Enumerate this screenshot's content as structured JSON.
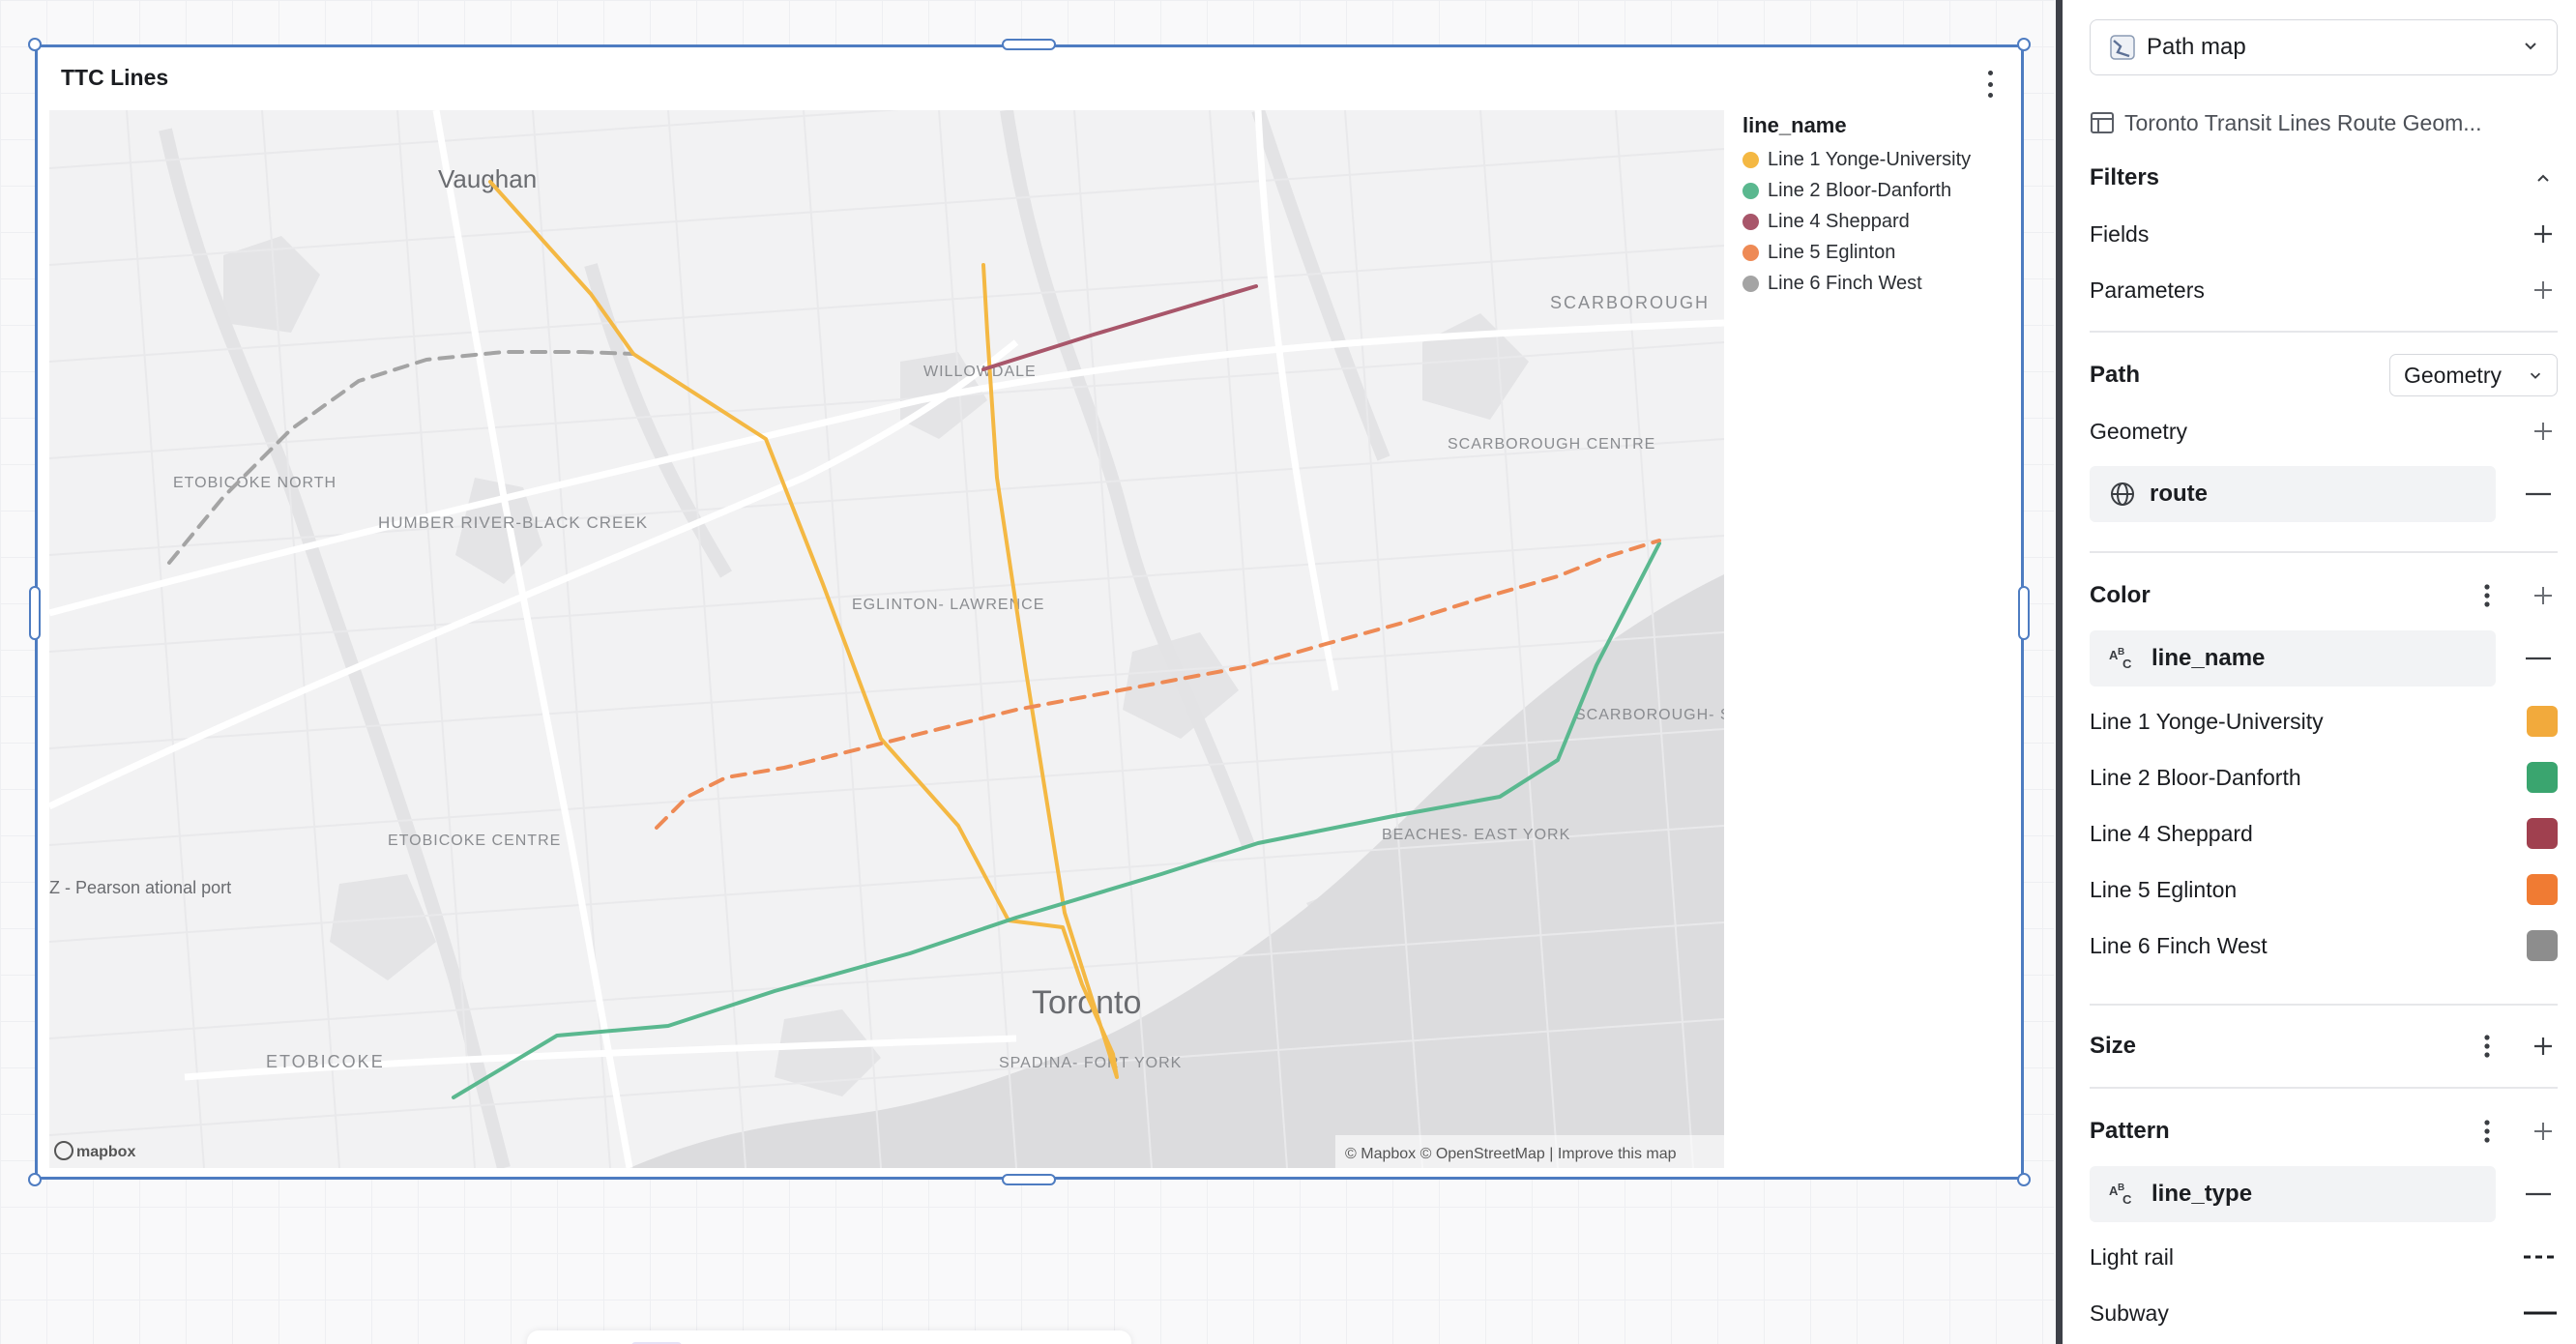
{
  "card": {
    "title": "TTC Lines"
  },
  "map": {
    "place_labels": {
      "vaughan": "Vaughan",
      "scarborough": "SCARBOROUGH",
      "willowdale": "WILLOWDALE",
      "etobicoke_north": "ETOBICOKE NORTH",
      "humber_river_black_creek": "HUMBER RIVER-BLACK CREEK",
      "scarborough_centre": "SCARBOROUGH CENTRE",
      "eglinton_lawrence": "EGLINTON- LAWRENCE",
      "scarborough_southwest": "SCARBOROUGH- SOUTHWEST",
      "beaches_east_york": "BEACHES- EAST YORK",
      "etobicoke_centre": "ETOBICOKE CENTRE",
      "pearson": "Z - Pearson ational port",
      "toronto": "Toronto",
      "spadina_fort_york": "SPADINA- FORT YORK",
      "etobicoke": "ETOBICOKE"
    },
    "logo": "mapbox",
    "attribution": "© Mapbox © OpenStreetMap | Improve this map"
  },
  "legend": {
    "title": "line_name",
    "items": [
      {
        "label": "Line 1 Yonge-University",
        "color": "#f4b843"
      },
      {
        "label": "Line 2 Bloor-Danforth",
        "color": "#5ab88f"
      },
      {
        "label": "Line 4 Sheppard",
        "color": "#a8566a"
      },
      {
        "label": "Line 5 Eglinton",
        "color": "#ee8a55"
      },
      {
        "label": "Line 6 Finch West",
        "color": "#a4a4a4"
      }
    ]
  },
  "panel": {
    "viz_type": "Path map",
    "viz_icon": "path-map-icon",
    "dataset": "Toronto Transit Lines Route Geom...",
    "filters": {
      "title": "Filters",
      "fields": "Fields",
      "parameters": "Parameters"
    },
    "path": {
      "title": "Path",
      "mode": "Geometry",
      "geometry_label": "Geometry",
      "field": "route"
    },
    "color": {
      "title": "Color",
      "field": "line_name",
      "values": [
        {
          "label": "Line 1 Yonge-University",
          "color": "#f2aa3c"
        },
        {
          "label": "Line 2 Bloor-Danforth",
          "color": "#3aa56f"
        },
        {
          "label": "Line 4 Sheppard",
          "color": "#a0404f"
        },
        {
          "label": "Line 5 Eglinton",
          "color": "#f07b33"
        },
        {
          "label": "Line 6 Finch West",
          "color": "#8d8d8d"
        }
      ]
    },
    "size": {
      "title": "Size"
    },
    "pattern": {
      "title": "Pattern",
      "field": "line_type",
      "values": [
        {
          "label": "Light rail",
          "style": "dashed"
        },
        {
          "label": "Subway",
          "style": "solid"
        }
      ]
    }
  }
}
